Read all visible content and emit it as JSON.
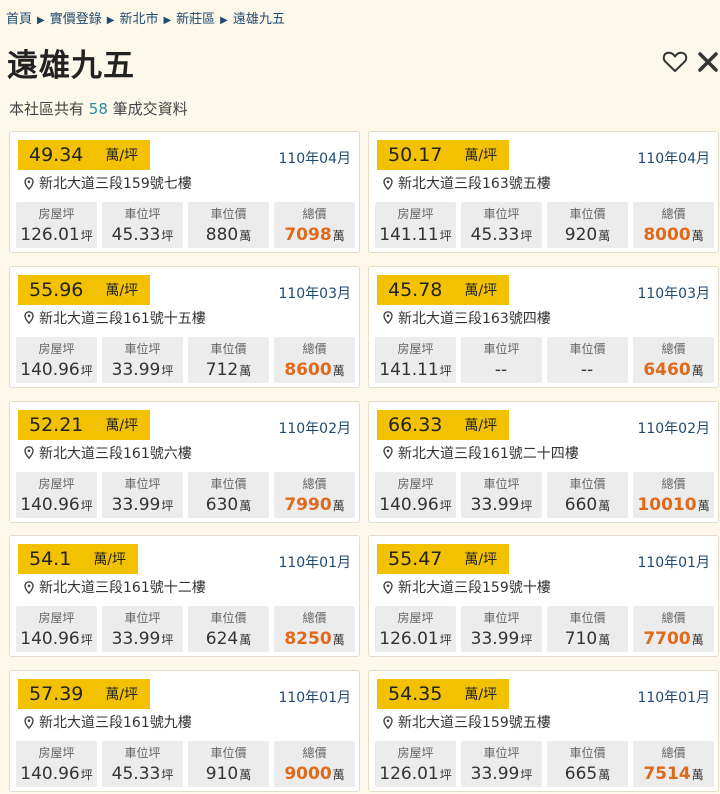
{
  "breadcrumb": [
    "首頁",
    "實價登錄",
    "新北市",
    "新莊區",
    "遠雄九五"
  ],
  "title": "遠雄九五",
  "summary": {
    "prefix": "本社區共有",
    "count": "58",
    "suffix": "筆成交資料"
  },
  "labels": {
    "house_area": "房屋坪",
    "parking_area": "車位坪",
    "parking_price": "車位價",
    "total": "總價",
    "price_unit": "萬/坪",
    "ping": "坪",
    "wan": "萬"
  },
  "colors": {
    "price_tag": "#f2c200",
    "total": "#e06a1c",
    "link": "#1f4a73",
    "count": "#2a8a9a"
  },
  "records": [
    {
      "price": "49.34",
      "date": "110年04月",
      "address": "新北大道三段159號七樓",
      "house_area": "126.01",
      "parking_area": "45.33",
      "parking_price": "880",
      "total": "7098"
    },
    {
      "price": "50.17",
      "date": "110年04月",
      "address": "新北大道三段163號五樓",
      "house_area": "141.11",
      "parking_area": "45.33",
      "parking_price": "920",
      "total": "8000"
    },
    {
      "price": "55.96",
      "date": "110年03月",
      "address": "新北大道三段161號十五樓",
      "house_area": "140.96",
      "parking_area": "33.99",
      "parking_price": "712",
      "total": "8600"
    },
    {
      "price": "45.78",
      "date": "110年03月",
      "address": "新北大道三段163號四樓",
      "house_area": "141.11",
      "parking_area": "--",
      "parking_price": "--",
      "total": "6460"
    },
    {
      "price": "52.21",
      "date": "110年02月",
      "address": "新北大道三段161號六樓",
      "house_area": "140.96",
      "parking_area": "33.99",
      "parking_price": "630",
      "total": "7990"
    },
    {
      "price": "66.33",
      "date": "110年02月",
      "address": "新北大道三段161號二十四樓",
      "house_area": "140.96",
      "parking_area": "33.99",
      "parking_price": "660",
      "total": "10010"
    },
    {
      "price": "54.1",
      "date": "110年01月",
      "address": "新北大道三段161號十二樓",
      "house_area": "140.96",
      "parking_area": "33.99",
      "parking_price": "624",
      "total": "8250"
    },
    {
      "price": "55.47",
      "date": "110年01月",
      "address": "新北大道三段159號十樓",
      "house_area": "126.01",
      "parking_area": "33.99",
      "parking_price": "710",
      "total": "7700"
    },
    {
      "price": "57.39",
      "date": "110年01月",
      "address": "新北大道三段161號九樓",
      "house_area": "140.96",
      "parking_area": "45.33",
      "parking_price": "910",
      "total": "9000"
    },
    {
      "price": "54.35",
      "date": "110年01月",
      "address": "新北大道三段159號五樓",
      "house_area": "126.01",
      "parking_area": "33.99",
      "parking_price": "665",
      "total": "7514"
    }
  ]
}
